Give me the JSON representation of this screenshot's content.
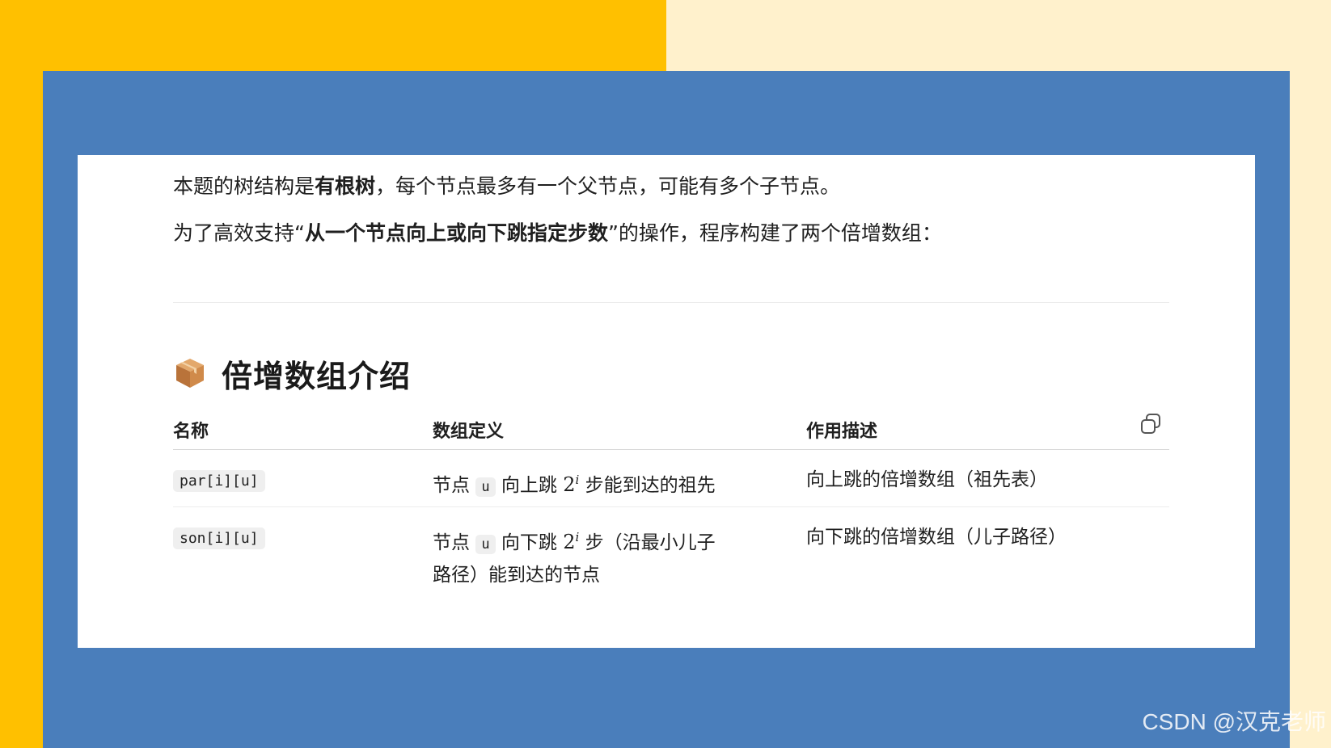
{
  "colors": {
    "accent_yellow": "#FFC000",
    "light_yellow": "#FFF1CC",
    "panel_blue": "#4A7EBB"
  },
  "intro": {
    "p1_pre": "本题的树结构是",
    "p1_bold": "有根树",
    "p1_post": "，每个节点最多有一个父节点，可能有多个子节点。",
    "p2_pre": "为了高效支持“",
    "p2_bold": "从一个节点向上或向下跳指定步数",
    "p2_post": "”的操作，程序构建了两个倍增数组："
  },
  "section": {
    "icon": "package-icon",
    "title": "倍增数组介绍"
  },
  "table": {
    "headers": [
      "名称",
      "数组定义",
      "作用描述"
    ],
    "copy_icon": "copy-icon",
    "rows": [
      {
        "name": "par[i][u]",
        "def_pre": "节点",
        "def_code": "u",
        "def_mid": "向上跳",
        "def_base": "2",
        "def_exp": "i",
        "def_post": "步能到达的祖先",
        "desc": "向上跳的倍增数组（祖先表）"
      },
      {
        "name": "son[i][u]",
        "def_pre": "节点",
        "def_code": "u",
        "def_mid": "向下跳",
        "def_base": "2",
        "def_exp": "i",
        "def_post": "步（沿最小儿子路径）能到达的节点",
        "desc": "向下跳的倍增数组（儿子路径）"
      }
    ]
  },
  "watermark": "CSDN @汉克老师"
}
